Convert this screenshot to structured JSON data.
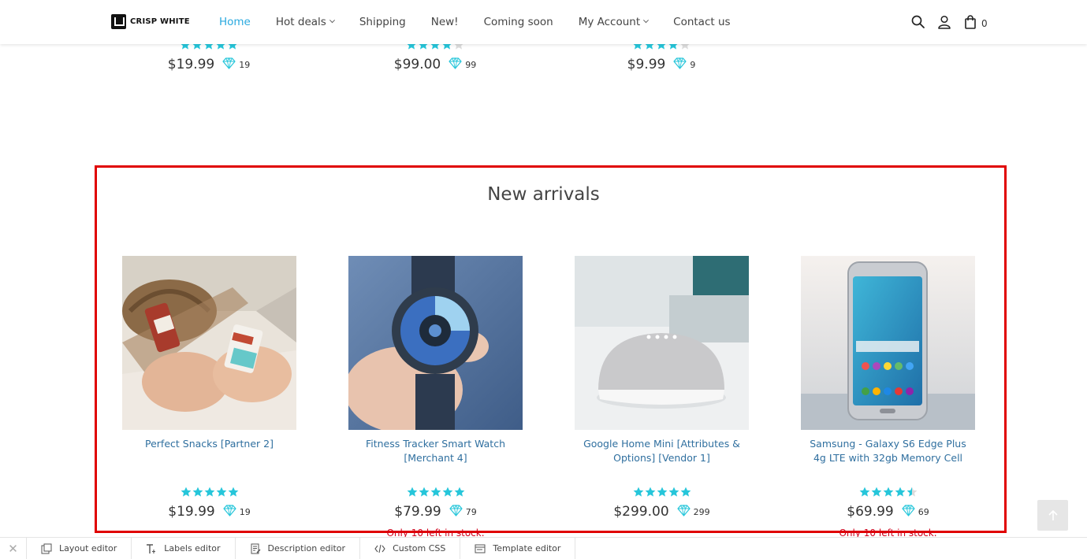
{
  "header": {
    "logo_text": "CRISP WHITE",
    "nav": [
      {
        "label": "Home",
        "active": true,
        "has_dropdown": false
      },
      {
        "label": "Hot deals",
        "active": false,
        "has_dropdown": true
      },
      {
        "label": "Shipping",
        "active": false,
        "has_dropdown": false
      },
      {
        "label": "New!",
        "active": false,
        "has_dropdown": false
      },
      {
        "label": "Coming soon",
        "active": false,
        "has_dropdown": false
      },
      {
        "label": "My Account",
        "active": false,
        "has_dropdown": true
      },
      {
        "label": "Contact us",
        "active": false,
        "has_dropdown": false
      }
    ],
    "cart_count": "0",
    "icons": [
      "search-icon",
      "user-icon",
      "bag-icon"
    ]
  },
  "top_products": [
    {
      "price": "$19.99",
      "points": "19",
      "rating": 5
    },
    {
      "price": "$99.00",
      "points": "99",
      "rating": 4
    },
    {
      "price": "$9.99",
      "points": "9",
      "rating": 4
    }
  ],
  "new_arrivals": {
    "title": "New arrivals",
    "products": [
      {
        "name": "Perfect Snacks [Partner 2]",
        "price": "$19.99",
        "points": "19",
        "rating": 5,
        "stock": ""
      },
      {
        "name": "Fitness Tracker Smart Watch [Merchant 4]",
        "price": "$79.99",
        "points": "79",
        "rating": 5,
        "stock": "Only 10 left in stock."
      },
      {
        "name": "Google Home Mini [Attributes & Options] [Vendor 1]",
        "price": "$299.00",
        "points": "299",
        "rating": 5,
        "stock": ""
      },
      {
        "name": "Samsung - Galaxy S6 Edge Plus 4g LTE with 32gb Memory Cell",
        "price": "$69.99",
        "points": "69",
        "rating": 4.5,
        "stock": "Only 10 left in stock."
      }
    ]
  },
  "toolbar": {
    "items": [
      {
        "label": "Layout editor",
        "icon": "layout-icon"
      },
      {
        "label": "Labels editor",
        "icon": "text-icon"
      },
      {
        "label": "Description editor",
        "icon": "description-icon"
      },
      {
        "label": "Custom CSS",
        "icon": "code-icon"
      },
      {
        "label": "Template editor",
        "icon": "template-icon"
      }
    ]
  },
  "colors": {
    "accent": "#29a9df",
    "star": "#26c6da",
    "link": "#2f6f9f",
    "stock_warning": "#d0021b",
    "highlight_border": "#e00000"
  }
}
